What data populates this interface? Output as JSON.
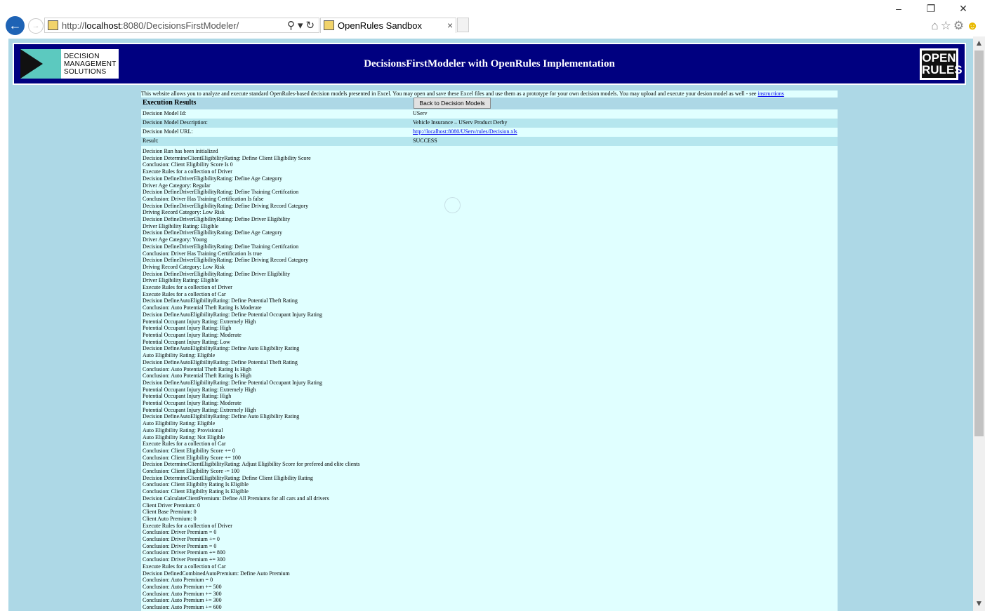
{
  "browser": {
    "url_prefix": "http://",
    "url_host": "localhost",
    "url_rest": ":8080/DecisionsFirstModeler/",
    "tab_title": "OpenRules Sandbox",
    "tab_close": "×",
    "window_controls": [
      "–",
      "❐",
      "✕"
    ]
  },
  "header": {
    "dms_logo_lines": [
      "DECISION",
      "MANAGEMENT",
      "SOLUTIONS"
    ],
    "title": "DecisionsFirstModeler with OpenRules Implementation",
    "openrules_logo_lines": [
      "OPEN",
      "RULES"
    ]
  },
  "intro": {
    "text": "This website allows you to analyze and execute standard OpenRules-based decision models presented in Excel. You may open and save these Excel files and use them as a prototype for your own decision models. You may upload and execute your desion model as well - see ",
    "link": "instructions"
  },
  "execution": {
    "title": "Execution Results",
    "back_button": "Back to Decision Models",
    "rows": [
      {
        "label": "Decision Model Id:",
        "value": "UServ"
      },
      {
        "label": "Decision Model Description:",
        "value": "Vehicle Insurance – UServ Product Derby"
      },
      {
        "label": "Decision Model URL:",
        "value": "http://localhost:8080/UServ/rules/Decision.xls"
      },
      {
        "label": "Result:",
        "value": "SUCCESS"
      }
    ]
  },
  "log": [
    "Decision Run has been initialized",
    "Decision DetermineClientEligibilityRating: Define Client Eligibility Score",
    "Conclusion: Client Eligibility Score Is 0",
    "Execute Rules for a collection of Driver",
    "Decision DefineDriverEligibilityRating: Define Age Category",
    "Driver Age Category: Regular",
    "Decision DefineDriverEligibilityRating: Define Training Certifcation",
    "Conclusion: Driver Has Training Certification Is false",
    "Decision DefineDriverEligibilityRating: Define Driving Record Category",
    "Driving Record Category: Low Risk",
    "Decision DefineDriverEligibilityRating: Define Driver Eligibility",
    "Driver Eligibility Rating: Eligible",
    "Decision DefineDriverEligibilityRating: Define Age Category",
    "Driver Age Category: Young",
    "Decision DefineDriverEligibilityRating: Define Training Certifcation",
    "Conclusion: Driver Has Training Certification Is true",
    "Decision DefineDriverEligibilityRating: Define Driving Record Category",
    "Driving Record Category: Low Risk",
    "Decision DefineDriverEligibilityRating: Define Driver Eligibility",
    "Driver Eligibility Rating: Eligible",
    "Execute Rules for a collection of Driver",
    "Execute Rules for a collection of Car",
    "Decision DefineAutoEligibilityRating: Define Potential Theft Rating",
    "Conclusion: Auto Potential Theft Rating Is Moderate",
    "Decision DefineAutoEligibilityRating: Define Potential Occupant Injury Rating",
    "Potential Occupant Injury Rating: Extremely High",
    "Potential Occupant Injury Rating: High",
    "Potential Occupant Injury Rating: Moderate",
    "Potential Occupant Injury Rating: Low",
    "Decision DefineAutoEligibilityRating: Define Auto Eligibility Rating",
    "Auto Eligibility Rating: Eligible",
    "Decision DefineAutoEligibilityRating: Define Potential Theft Rating",
    "Conclusion: Auto Potential Theft Rating Is High",
    "Conclusion: Auto Potential Theft Rating Is High",
    "Decision DefineAutoEligibilityRating: Define Potential Occupant Injury Rating",
    "Potential Occupant Injury Rating: Extremely High",
    "Potential Occupant Injury Rating: High",
    "Potential Occupant Injury Rating: Moderate",
    "Potential Occupant Injury Rating: Extremely High",
    "Decision DefineAutoEligibilityRating: Define Auto Eligibility Rating",
    "Auto Eligibility Rating: Eligible",
    "Auto Eligibility Rating: Provisional",
    "Auto Eligibility Rating: Not Eligible",
    "Execute Rules for a collection of Car",
    "Conclusion: Client Eligibility Score += 0",
    "Conclusion: Client Eligibility Score += 100",
    "Decision DetermineClientEligibilityRating: Adjust Eligibility Score for prefered and elite clients",
    "Conclusion: Client Eligibility Score -= 100",
    "Decision DetermineClientEligibilityRating: Define Client Eligibility Rating",
    "Conclusion: Client Eligibilty Rating Is Eligible",
    "Conclusion: Client Eligibilty Rating Is Eligible",
    "Decision CalculateClientPremium: Define All Premiums for all cars and all drivers",
    "Client Driver Premium: 0",
    "Client Base Premium: 0",
    "Client Auto Premium: 0",
    "Execute Rules for a collection of Driver",
    "Conclusion: Driver Premium = 0",
    "Conclusion: Driver Premium += 0",
    "Conclusion: Driver Premium = 0",
    "Conclusion: Driver Premium += 800",
    "Conclusion: Driver Premium += 300",
    "Execute Rules for a collection of Car",
    "Decision DefinedCombinedAutoPremium: Define Auto Premium",
    "Conclusion: Auto Premium = 0",
    "Conclusion: Auto Premium += 500",
    "Conclusion: Auto Premium += 300",
    "Conclusion: Auto Premium += 300",
    "Conclusion: Auto Premium += 600"
  ]
}
